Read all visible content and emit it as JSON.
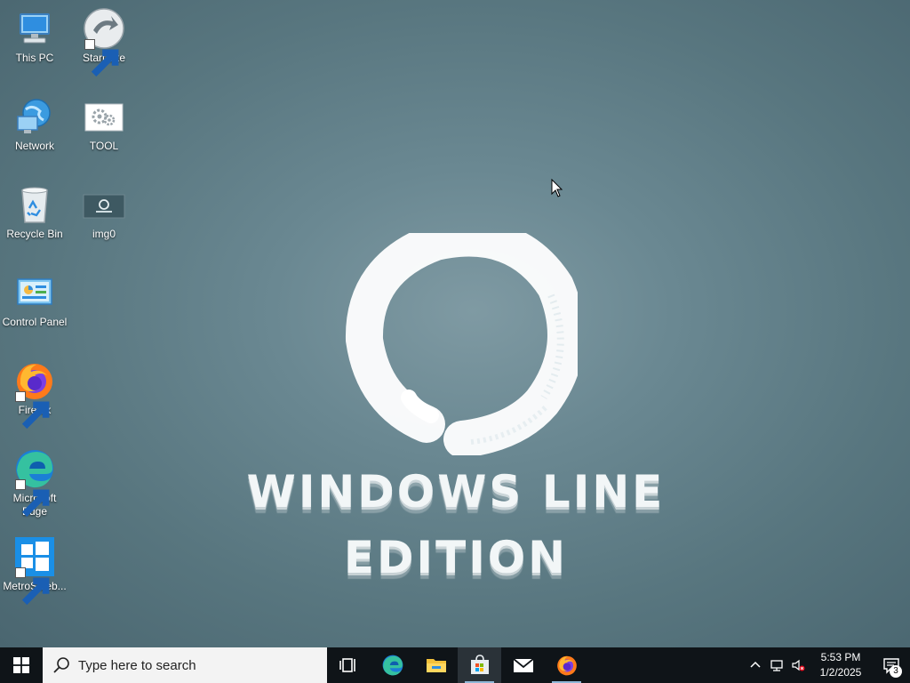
{
  "desktop": {
    "icons": [
      {
        "label": "This PC",
        "icon": "computer-icon"
      },
      {
        "label": "Start.exe",
        "icon": "start-exe-icon"
      },
      {
        "label": "Network",
        "icon": "network-icon"
      },
      {
        "label": "TOOL",
        "icon": "tool-gears-icon"
      },
      {
        "label": "Recycle Bin",
        "icon": "recycle-bin-icon"
      },
      {
        "label": "img0",
        "icon": "image-file-icon"
      },
      {
        "label": "Control Panel",
        "icon": "control-panel-icon"
      },
      {
        "label": "Firefox",
        "icon": "firefox-icon"
      },
      {
        "label": "Microsoft Edge",
        "icon": "edge-icon"
      },
      {
        "label": "MetroSideb...",
        "icon": "metro-sidebar-icon"
      }
    ]
  },
  "wallpaper": {
    "title": "WINDOWS LINE EDITION"
  },
  "taskbar": {
    "search_placeholder": "Type here to search",
    "pinned": [
      {
        "name": "Task View",
        "icon": "task-view-icon",
        "running": false
      },
      {
        "name": "Microsoft Edge",
        "icon": "edge-icon",
        "running": false
      },
      {
        "name": "File Explorer",
        "icon": "folder-icon",
        "running": false
      },
      {
        "name": "Microsoft Store",
        "icon": "store-icon",
        "running": true
      },
      {
        "name": "Mail",
        "icon": "mail-icon",
        "running": false
      },
      {
        "name": "Firefox",
        "icon": "firefox-icon",
        "running": true
      }
    ],
    "tray": {
      "time": "5:53 PM",
      "date": "1/2/2025",
      "notification_count": "3"
    }
  },
  "colors": {
    "taskbar_bg": "#0f1418",
    "desktop_bg": "#5b7a85",
    "accent": "#0078d7"
  }
}
